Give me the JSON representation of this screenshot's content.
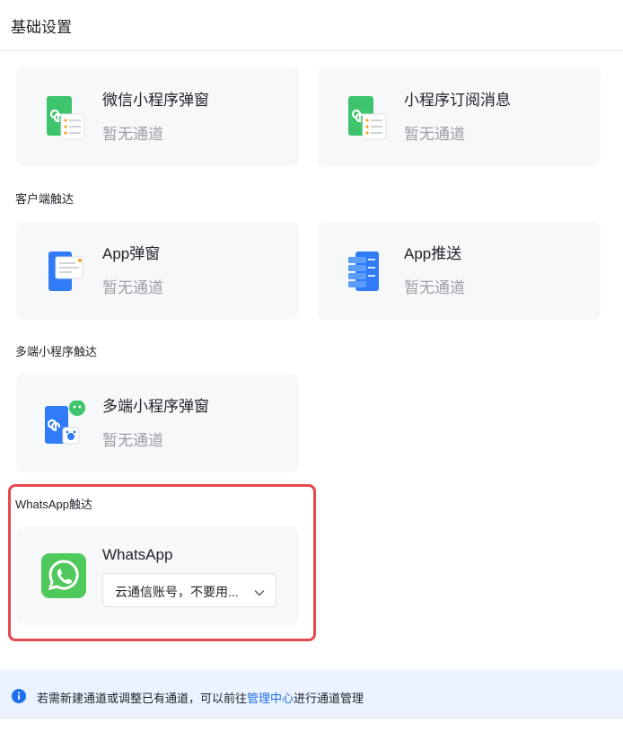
{
  "header": {
    "title": "基础设置"
  },
  "sections": {
    "client": "客户端触达",
    "multi": "多端小程序触达",
    "whatsapp": "WhatsApp触达"
  },
  "cards": {
    "wechat_popup": {
      "title": "微信小程序弹窗",
      "sub": "暂无通道"
    },
    "subscribe_msg": {
      "title": "小程序订阅消息",
      "sub": "暂无通道"
    },
    "app_popup": {
      "title": "App弹窗",
      "sub": "暂无通道"
    },
    "app_push": {
      "title": "App推送",
      "sub": "暂无通道"
    },
    "multi_popup": {
      "title": "多端小程序弹窗",
      "sub": "暂无通道"
    },
    "whatsapp": {
      "title": "WhatsApp",
      "select_value": "云通信账号，不要用..."
    }
  },
  "info": {
    "prefix": "若需新建通道或调整已有通道，可以前往",
    "link": "管理中心",
    "suffix": "进行通道管理"
  },
  "colors": {
    "card_bg": "#f7f8fa",
    "highlight": "#e5484d",
    "link": "#1f6feb",
    "info_bg": "#eaf3ff",
    "mini_green": "#3ec46d",
    "app_blue": "#2f7cf6",
    "whatsapp_green": "#4fc95b"
  },
  "icons": {
    "wechat_popup": "mini-program-list-icon",
    "subscribe_msg": "mini-program-list-icon",
    "app_popup": "app-popup-icon",
    "app_push": "app-push-icon",
    "multi_popup": "multi-platform-mini-program-icon",
    "whatsapp": "whatsapp-logo-icon",
    "info": "info-circle-icon",
    "select": "chevron-down-icon"
  }
}
